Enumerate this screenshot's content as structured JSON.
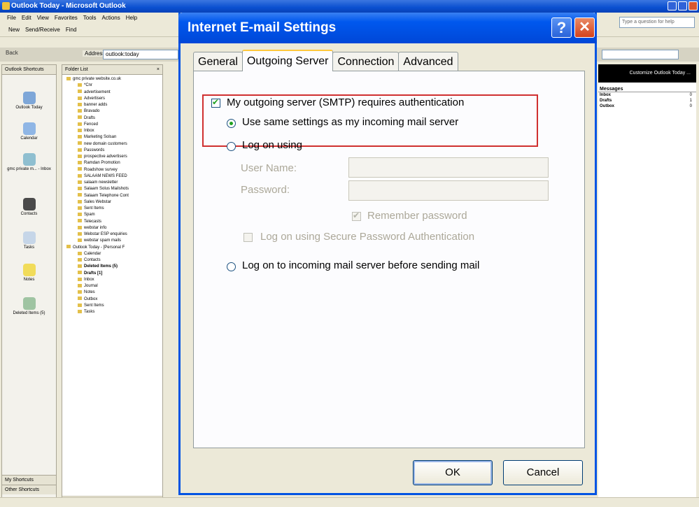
{
  "outlook": {
    "title": "Outlook Today - Microsoft Outlook",
    "menu": [
      "File",
      "Edit",
      "View",
      "Favorites",
      "Tools",
      "Actions",
      "Help"
    ],
    "toolbar": [
      "New",
      "Send/Receive",
      "Find"
    ],
    "help_placeholder": "Type a question for help",
    "back_label": "Back",
    "address_label": "Address",
    "address_value": "outlook:today",
    "shortcuts_header": "Outlook Shortcuts",
    "shortcuts": [
      {
        "label": "Outlook Today",
        "icon": "outlook-today-icon"
      },
      {
        "label": "Calendar",
        "icon": "calendar-icon"
      },
      {
        "label": "gmc private m... - Inbox",
        "icon": "inbox-icon"
      },
      {
        "label": "Contacts",
        "icon": "contacts-icon"
      },
      {
        "label": "Tasks",
        "icon": "tasks-icon"
      },
      {
        "label": "Notes",
        "icon": "notes-icon"
      },
      {
        "label": "Deleted Items (5)",
        "icon": "deleted-items-icon"
      }
    ],
    "shortcut_footer": [
      "My Shortcuts",
      "Other Shortcuts"
    ],
    "folder_list_header": "Folder List",
    "folders": [
      {
        "name": "gmc private website.co.uk",
        "level": "root",
        "bold": false
      },
      {
        "name": "*Cnr",
        "level": "sub",
        "bold": false
      },
      {
        "name": "advertisement",
        "level": "sub",
        "bold": false
      },
      {
        "name": "Advertisers",
        "level": "sub",
        "bold": false
      },
      {
        "name": "banner adds",
        "level": "sub",
        "bold": false
      },
      {
        "name": "Bravado",
        "level": "sub",
        "bold": false
      },
      {
        "name": "Drafts",
        "level": "sub",
        "bold": false
      },
      {
        "name": "Fenced",
        "level": "sub",
        "bold": false
      },
      {
        "name": "Inbox",
        "level": "sub",
        "bold": false
      },
      {
        "name": "Marketing Solsan",
        "level": "sub",
        "bold": false
      },
      {
        "name": "new domain customers",
        "level": "sub",
        "bold": false
      },
      {
        "name": "Passwords",
        "level": "sub",
        "bold": false
      },
      {
        "name": "prospective advertisers",
        "level": "sub",
        "bold": false
      },
      {
        "name": "Ramdan Promotion",
        "level": "sub",
        "bold": false
      },
      {
        "name": "Roadshow survey",
        "level": "sub",
        "bold": false
      },
      {
        "name": "SALAAM NEWS FEED",
        "level": "sub",
        "bold": false
      },
      {
        "name": "salaam newsletter",
        "level": "sub",
        "bold": false
      },
      {
        "name": "Salaam Solus Mailshots",
        "level": "sub",
        "bold": false
      },
      {
        "name": "Salaam Telephone Cont",
        "level": "sub",
        "bold": false
      },
      {
        "name": "Sales Webstar",
        "level": "sub",
        "bold": false
      },
      {
        "name": "Sent Items",
        "level": "sub",
        "bold": false
      },
      {
        "name": "Spam",
        "level": "sub",
        "bold": false
      },
      {
        "name": "Telecasts",
        "level": "sub",
        "bold": false
      },
      {
        "name": "webstar info",
        "level": "sub",
        "bold": false
      },
      {
        "name": "Webstar ESP enquiries",
        "level": "sub",
        "bold": false
      },
      {
        "name": "webstar spam mails",
        "level": "sub",
        "bold": false
      },
      {
        "name": "Outlook Today - [Personal F",
        "level": "root",
        "bold": false
      },
      {
        "name": "Calendar",
        "level": "sub",
        "bold": false
      },
      {
        "name": "Contacts",
        "level": "sub",
        "bold": false
      },
      {
        "name": "Deleted Items (5)",
        "level": "sub",
        "bold": true
      },
      {
        "name": "Drafts [1]",
        "level": "sub",
        "bold": true
      },
      {
        "name": "Inbox",
        "level": "sub",
        "bold": false
      },
      {
        "name": "Journal",
        "level": "sub",
        "bold": false
      },
      {
        "name": "Notes",
        "level": "sub",
        "bold": false
      },
      {
        "name": "Outbox",
        "level": "sub",
        "bold": false
      },
      {
        "name": "Sent Items",
        "level": "sub",
        "bold": false
      },
      {
        "name": "Tasks",
        "level": "sub",
        "bold": false
      }
    ],
    "content_banner": "Customize Outlook Today ...",
    "messages_header": "Messages",
    "message_rows": [
      {
        "name": "Inbox",
        "count": "0"
      },
      {
        "name": "Drafts",
        "count": "1"
      },
      {
        "name": "Outbox",
        "count": "0"
      }
    ]
  },
  "dialog": {
    "title": "Internet E-mail Settings",
    "help_glyph": "?",
    "close_glyph": "✕",
    "tabs": [
      "General",
      "Outgoing Server",
      "Connection",
      "Advanced"
    ],
    "active_tab": "Outgoing Server",
    "smtp_auth_label": "My outgoing server (SMTP) requires authentication",
    "smtp_auth_checked": true,
    "use_same_label": "Use same settings as my incoming mail server",
    "log_on_using_label": "Log on using",
    "user_name_label": "User Name:",
    "password_label": "Password:",
    "remember_password_label": "Remember password",
    "spa_label": "Log on using Secure Password Authentication",
    "log_on_incoming_label": "Log on to incoming mail server before sending mail",
    "ok_label": "OK",
    "cancel_label": "Cancel",
    "colors": {
      "title_bar": "#0054e3",
      "highlight": "#d03030",
      "check": "#21a121"
    }
  }
}
